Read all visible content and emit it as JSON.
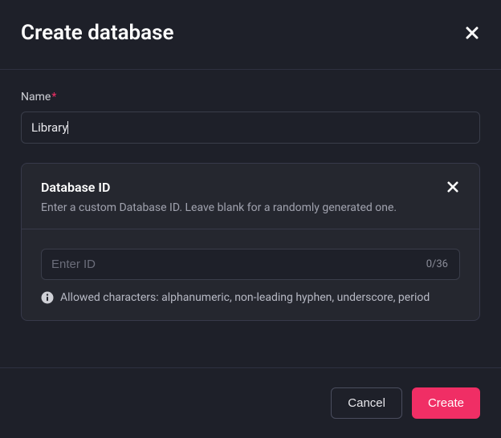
{
  "modal": {
    "title": "Create database"
  },
  "nameField": {
    "label": "Name",
    "value": "Library",
    "required": true
  },
  "databaseId": {
    "title": "Database ID",
    "subtitle": "Enter a custom Database ID. Leave blank for a randomly generated one.",
    "placeholder": "Enter ID",
    "value": "",
    "counter": "0/36",
    "hint": "Allowed characters: alphanumeric, non-leading hyphen, underscore, period"
  },
  "footer": {
    "cancel": "Cancel",
    "create": "Create"
  }
}
